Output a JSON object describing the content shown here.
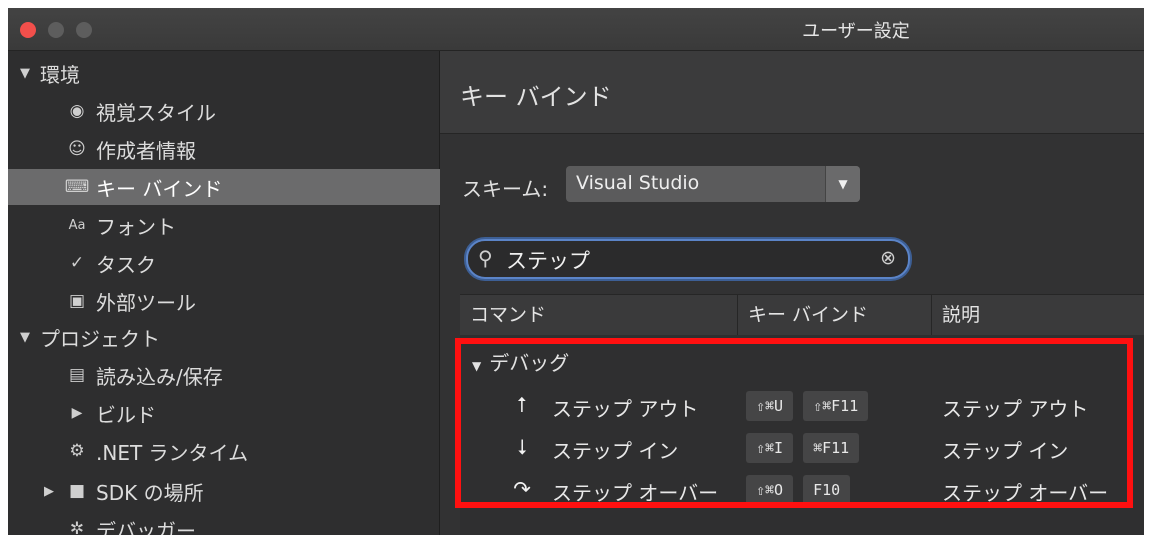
{
  "window": {
    "title": "ユーザー設定"
  },
  "sidebar": {
    "items": [
      {
        "label": "環境",
        "icon": "triangle-down",
        "glyph": "▼"
      },
      {
        "label": "視覚スタイル",
        "icon": "eye-icon",
        "glyph": "◉"
      },
      {
        "label": "作成者情報",
        "icon": "smiley-icon",
        "glyph": "☺"
      },
      {
        "label": "キー バインド",
        "icon": "keyboard-icon",
        "glyph": "⌨"
      },
      {
        "label": "フォント",
        "icon": "font-icon",
        "glyph": "Aa"
      },
      {
        "label": "タスク",
        "icon": "check-icon",
        "glyph": "✓"
      },
      {
        "label": "外部ツール",
        "icon": "terminal-icon",
        "glyph": "▣"
      },
      {
        "label": "プロジェクト",
        "icon": "triangle-down",
        "glyph": "▼"
      },
      {
        "label": "読み込み/保存",
        "icon": "disk-icon",
        "glyph": "▤"
      },
      {
        "label": "ビルド",
        "icon": "build-icon",
        "glyph": "▶"
      },
      {
        "label": ".NET ランタイム",
        "icon": "gear-icon",
        "glyph": "⚙"
      },
      {
        "label": "SDK の場所",
        "icon": "folder-icon",
        "glyph": "■"
      },
      {
        "label": "デバッガー",
        "icon": "bug-icon",
        "glyph": "✲"
      }
    ],
    "selected_index": 3
  },
  "main": {
    "title": "キー バインド",
    "scheme_label": "スキーム:",
    "scheme_value": "Visual Studio",
    "search_value": "ステップ",
    "table": {
      "columns": [
        "コマンド",
        "キー バインド",
        "説明"
      ],
      "group": "デバッグ",
      "rows": [
        {
          "icon": "step-out-icon",
          "glyph": "⭡",
          "command": "ステップ アウト",
          "keys": [
            "⇧⌘U",
            "⇧⌘F11"
          ],
          "description": "ステップ アウト"
        },
        {
          "icon": "step-into-icon",
          "glyph": "⭣",
          "command": "ステップ イン",
          "keys": [
            "⇧⌘I",
            "⌘F11"
          ],
          "description": "ステップ イン"
        },
        {
          "icon": "step-over-icon",
          "glyph": "↷",
          "command": "ステップ オーバー",
          "keys": [
            "⇧⌘O",
            "F10"
          ],
          "description": "ステップ オーバー"
        }
      ]
    }
  },
  "colors": {
    "highlight": "#ff1010",
    "accent": "#5b84c8",
    "close": "#f24f4b"
  }
}
